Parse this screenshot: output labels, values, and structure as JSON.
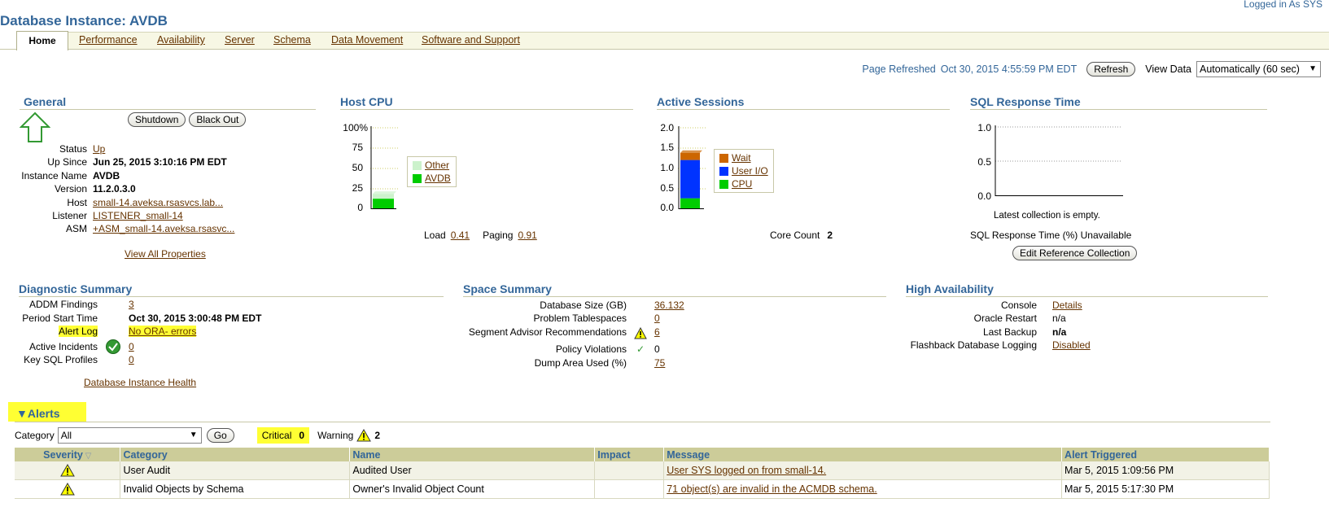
{
  "header": {
    "title": "Database Instance: AVDB",
    "logged_in": "Logged in As SYS"
  },
  "tabs": [
    "Home",
    "Performance",
    "Availability",
    "Server",
    "Schema",
    "Data Movement",
    "Software and Support"
  ],
  "refresh": {
    "label": "Page Refreshed",
    "time": "Oct 30, 2015 4:55:59 PM EDT",
    "button": "Refresh",
    "view_data_label": "View Data",
    "view_data_value": "Automatically (60 sec)"
  },
  "general": {
    "title": "General",
    "shutdown": "Shutdown",
    "blackout": "Black Out",
    "rows": [
      {
        "label": "Status",
        "value": "Up"
      },
      {
        "label": "Up Since",
        "value": "Jun 25, 2015 3:10:16 PM EDT"
      },
      {
        "label": "Instance Name",
        "value": "AVDB"
      },
      {
        "label": "Version",
        "value": "11.2.0.3.0"
      },
      {
        "label": "Host",
        "value": "small-14.aveksa.rsasvcs.lab..."
      },
      {
        "label": "Listener",
        "value": "LISTENER_small-14"
      },
      {
        "label": "ASM",
        "value": "+ASM_small-14.aveksa.rsasvc..."
      }
    ],
    "view_all": "View All Properties",
    "status_arrow_color": "#339933"
  },
  "host_cpu": {
    "title": "Host CPU",
    "load_label": "Load",
    "load_value": "0.41",
    "paging_label": "Paging",
    "paging_value": "0.91"
  },
  "active_sessions": {
    "title": "Active Sessions",
    "core_label": "Core Count",
    "core_value": "2"
  },
  "sql_response": {
    "title": "SQL Response Time",
    "empty_msg": "Latest collection is empty.",
    "unavailable": "SQL Response Time (%) Unavailable",
    "edit_button": "Edit Reference Collection"
  },
  "chart_data": [
    {
      "type": "bar",
      "yticks": [
        "100%",
        "75",
        "50",
        "25",
        "0"
      ],
      "ylim": [
        0,
        100
      ],
      "series": [
        {
          "name": "Other",
          "color": "#ccf2cc",
          "values": [
            6
          ]
        },
        {
          "name": "AVDB",
          "color": "#00cc00",
          "values": [
            12
          ]
        }
      ]
    },
    {
      "type": "bar",
      "yticks": [
        "2.0",
        "1.5",
        "1.0",
        "0.5",
        "0.0"
      ],
      "ylim": [
        0,
        2
      ],
      "series": [
        {
          "name": "Wait",
          "color": "#cc6600",
          "values": [
            0.18
          ]
        },
        {
          "name": "User I/O",
          "color": "#0033ff",
          "values": [
            0.95
          ]
        },
        {
          "name": "CPU",
          "color": "#00cc00",
          "values": [
            0.25
          ]
        }
      ]
    },
    {
      "type": "line",
      "yticks": [
        "1.0",
        "0.5",
        "0.0"
      ],
      "ylim": [
        0,
        1
      ],
      "series": []
    }
  ],
  "diagnostic": {
    "title": "Diagnostic Summary",
    "rows": [
      {
        "label": "ADDM Findings",
        "value": "3"
      },
      {
        "label": "Period Start Time",
        "value": "Oct 30, 2015 3:00:48 PM EDT"
      },
      {
        "label": "Alert Log",
        "value": "No ORA- errors"
      },
      {
        "label": "Active Incidents",
        "value": "0"
      },
      {
        "label": "Key SQL Profiles",
        "value": "0"
      }
    ],
    "health_link": "Database Instance Health"
  },
  "space": {
    "title": "Space Summary",
    "rows": [
      {
        "label": "Database Size (GB)",
        "value": "36.132"
      },
      {
        "label": "Problem Tablespaces",
        "value": "0"
      },
      {
        "label": "Segment Advisor Recommendations",
        "value": "6"
      },
      {
        "label": "Policy Violations",
        "value": "0"
      },
      {
        "label": "Dump Area Used (%)",
        "value": "75"
      }
    ]
  },
  "ha": {
    "title": "High Availability",
    "rows": [
      {
        "label": "Console",
        "value": "Details"
      },
      {
        "label": "Oracle Restart",
        "value": "n/a"
      },
      {
        "label": "Last Backup",
        "value": "n/a"
      },
      {
        "label": "Flashback Database Logging",
        "value": "Disabled"
      }
    ]
  },
  "alerts": {
    "title": "Alerts",
    "category_label": "Category",
    "category_value": "All",
    "go": "Go",
    "critical_label": "Critical",
    "critical_value": "0",
    "warning_label": "Warning",
    "warning_value": "2",
    "columns": [
      "Severity",
      "Category",
      "Name",
      "Impact",
      "Message",
      "Alert Triggered"
    ],
    "rows": [
      {
        "category": "User Audit",
        "name": "Audited User",
        "impact": "",
        "message": "User SYS logged on from small-14.",
        "triggered": "Mar 5, 2015 1:09:56 PM"
      },
      {
        "category": "Invalid Objects by Schema",
        "name": "Owner's Invalid Object Count",
        "impact": "",
        "message": "71 object(s) are invalid in the ACMDB schema.",
        "triggered": "Mar 5, 2015 5:17:30 PM"
      }
    ]
  }
}
